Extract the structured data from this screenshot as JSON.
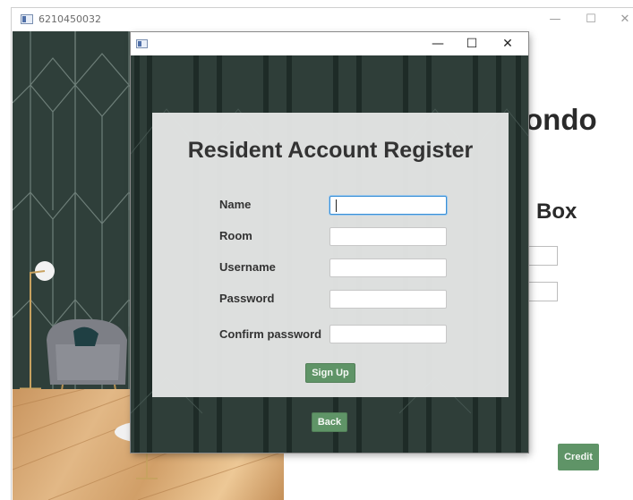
{
  "background_window": {
    "title": "6210450032",
    "controls": {
      "minimize": "—",
      "maximize": "☐",
      "close": "✕"
    },
    "heading_partial": "ondo",
    "subheading_partial": "Box",
    "credit_label": "Credit"
  },
  "dialog": {
    "title": "",
    "controls": {
      "minimize": "—",
      "maximize": "☐",
      "close": "✕"
    },
    "form": {
      "title": "Resident Account Register",
      "fields": [
        {
          "label": "Name",
          "value": ""
        },
        {
          "label": "Room",
          "value": ""
        },
        {
          "label": "Username",
          "value": ""
        },
        {
          "label": "Password",
          "value": ""
        },
        {
          "label": "Confirm password",
          "value": ""
        }
      ],
      "signup_label": "Sign Up"
    },
    "back_label": "Back"
  },
  "colors": {
    "accent_green": "#5f9467",
    "dark_teal": "#2f3e39",
    "panel_gray": "#e4e6e5",
    "focus_blue": "#3a8fd6"
  },
  "icons": [
    "window-app-icon",
    "minimize-icon",
    "maximize-icon",
    "close-icon"
  ]
}
